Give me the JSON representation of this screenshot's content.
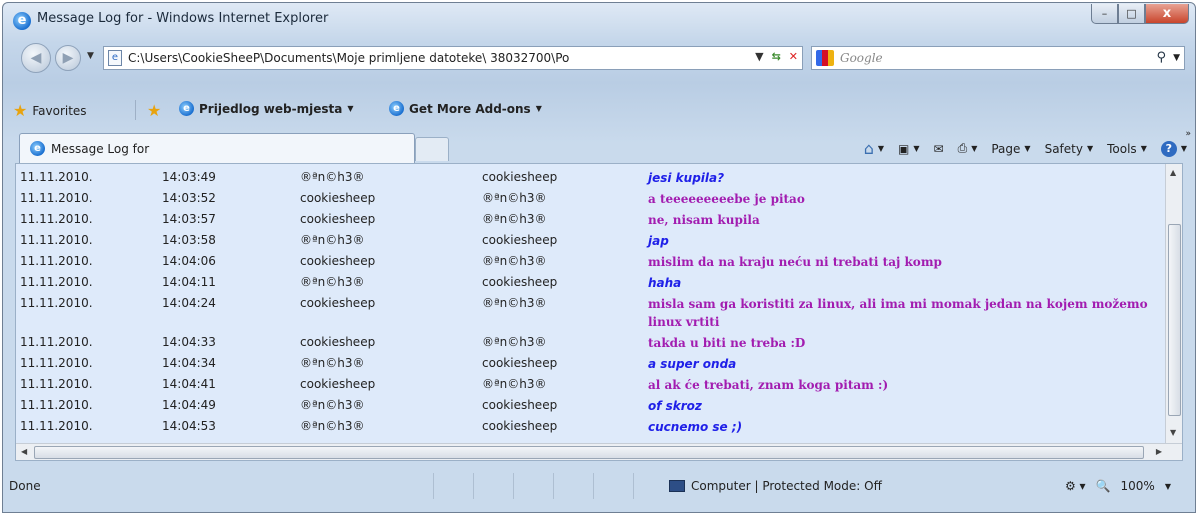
{
  "window": {
    "title": "Message Log for - Windows Internet Explorer",
    "minimize": "–",
    "maximize": "□",
    "close": "x"
  },
  "nav": {
    "address": "C:\\Users\\CookieSheeP\\Documents\\Moje primljene datoteke\\                        38032700\\Po",
    "search_placeholder": "Google"
  },
  "favorites": {
    "favorites_label": "Favorites",
    "suggested_sites": "Prijedlog web-mjesta",
    "get_addons": "Get More Add-ons"
  },
  "tab": {
    "title": "Message Log for"
  },
  "commands": {
    "page": "Page",
    "safety": "Safety",
    "tools": "Tools"
  },
  "messages": [
    {
      "date": "11.11.2010.",
      "time": "14:03:49",
      "from": "®ªn©h3®",
      "to": "cookiesheep",
      "text": "jesi kupila?",
      "style": "blue"
    },
    {
      "date": "11.11.2010.",
      "time": "14:03:52",
      "from": "cookiesheep",
      "to": "®ªn©h3®",
      "text": "a teeeeeeeeebe je pitao",
      "style": "purple"
    },
    {
      "date": "11.11.2010.",
      "time": "14:03:57",
      "from": "cookiesheep",
      "to": "®ªn©h3®",
      "text": "ne, nisam kupila",
      "style": "purple"
    },
    {
      "date": "11.11.2010.",
      "time": "14:03:58",
      "from": "®ªn©h3®",
      "to": "cookiesheep",
      "text": "jap",
      "style": "blue"
    },
    {
      "date": "11.11.2010.",
      "time": "14:04:06",
      "from": "cookiesheep",
      "to": "®ªn©h3®",
      "text": "mislim da na kraju neću ni trebati taj komp",
      "style": "purple"
    },
    {
      "date": "11.11.2010.",
      "time": "14:04:11",
      "from": "®ªn©h3®",
      "to": "cookiesheep",
      "text": "haha",
      "style": "blue"
    },
    {
      "date": "11.11.2010.",
      "time": "14:04:24",
      "from": "cookiesheep",
      "to": "®ªn©h3®",
      "text": "misla sam ga koristiti za linux, ali ima mi momak jedan na kojem možemo linux vrtiti",
      "style": "purple"
    },
    {
      "date": "11.11.2010.",
      "time": "14:04:33",
      "from": "cookiesheep",
      "to": "®ªn©h3®",
      "text": "takda u biti ne treba :D",
      "style": "purple"
    },
    {
      "date": "11.11.2010.",
      "time": "14:04:34",
      "from": "®ªn©h3®",
      "to": "cookiesheep",
      "text": "a super onda",
      "style": "blue"
    },
    {
      "date": "11.11.2010.",
      "time": "14:04:41",
      "from": "cookiesheep",
      "to": "®ªn©h3®",
      "text": "al ak će trebati, znam koga pitam :)",
      "style": "purple"
    },
    {
      "date": "11.11.2010.",
      "time": "14:04:49",
      "from": "®ªn©h3®",
      "to": "cookiesheep",
      "text": "of skroz",
      "style": "blue"
    },
    {
      "date": "11.11.2010.",
      "time": "14:04:53",
      "from": "®ªn©h3®",
      "to": "cookiesheep",
      "text": "cucnemo se ;)",
      "style": "blue"
    }
  ],
  "status": {
    "text": "Done",
    "zone": "Computer | Protected Mode: Off",
    "zoom": "100%"
  },
  "colors": {
    "blue_message": "#1f20e8",
    "purple_message": "#a21cb0",
    "content_bg": "#deeafa"
  }
}
